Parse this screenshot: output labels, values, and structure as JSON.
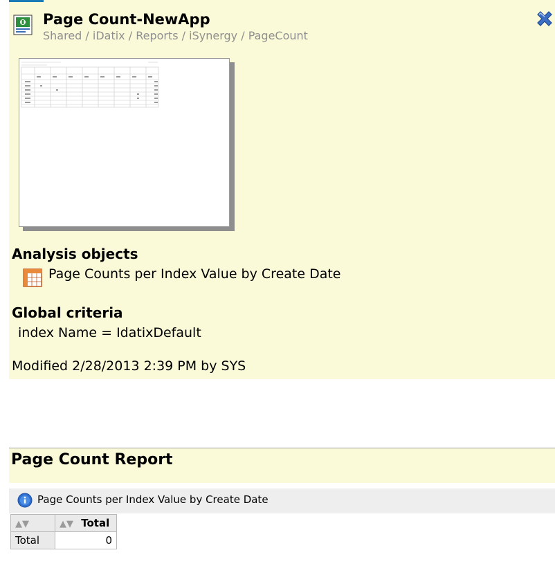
{
  "header": {
    "title": "Page Count-NewApp",
    "breadcrumb": "Shared / iDatix / Reports / iSynergy / PageCount"
  },
  "analysis": {
    "heading": "Analysis objects",
    "items": [
      {
        "label": "Page Counts per Index Value by Create Date"
      }
    ]
  },
  "criteria": {
    "heading": "Global criteria",
    "value": "index Name = IdatixDefault"
  },
  "modified": "Modified 2/28/2013 2:39 PM by SYS",
  "report": {
    "title": "Page Count Report",
    "dataview_title": "Page Counts per Index Value by Create Date",
    "table": {
      "columns": [
        "",
        "Total"
      ],
      "rows": [
        {
          "label": "Total",
          "value": "0"
        }
      ]
    }
  },
  "colors": {
    "panel_bg": "#fafad9",
    "accent_blue": "#3c6fc4",
    "breadcrumb_gray": "#8f8f8f"
  },
  "icons": {
    "report": "report-document-icon",
    "close": "close-x-icon",
    "table": "table-grid-icon",
    "info": "info-icon"
  }
}
